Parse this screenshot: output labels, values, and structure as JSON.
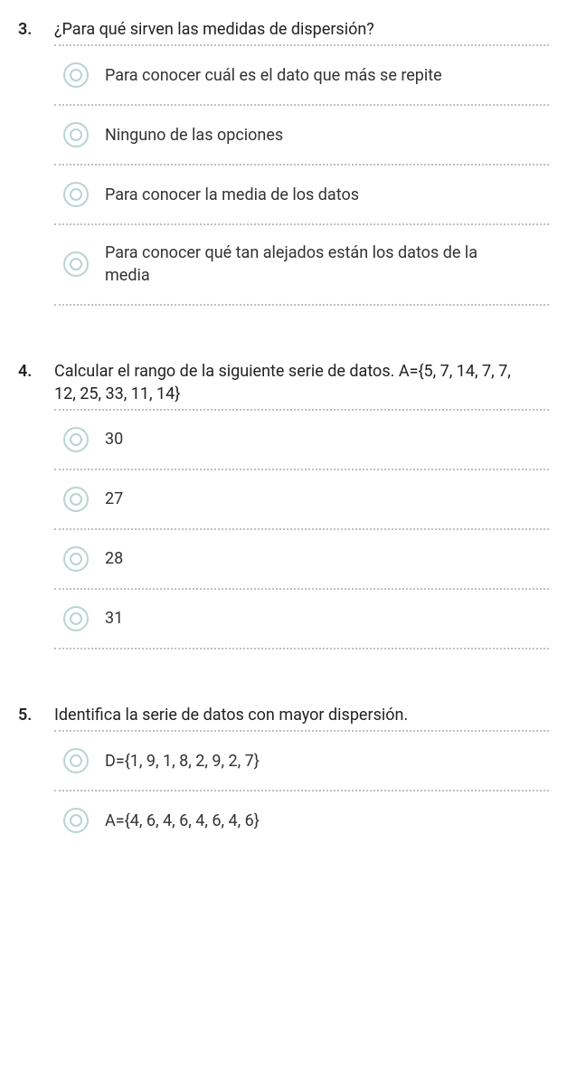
{
  "questions": [
    {
      "number": "3.",
      "text": "¿Para qué sirven las medidas de dispersión?",
      "options": [
        "Para conocer cuál es el dato que más se repite",
        "Ninguno de las opciones",
        "Para conocer la media de los datos",
        "Para conocer qué tan alejados están los datos de la media"
      ]
    },
    {
      "number": "4.",
      "text": "Calcular el rango de la siguiente serie de datos. A={5, 7, 14, 7, 7, 12, 25, 33, 11, 14}",
      "options": [
        "30",
        "27",
        "28",
        "31"
      ]
    },
    {
      "number": "5.",
      "text": "Identifica la serie de datos con mayor dispersión.",
      "options": [
        "D={1, 9, 1, 8, 2, 9, 2, 7}",
        "A={4, 6, 4, 6, 4, 6, 4, 6}"
      ]
    }
  ]
}
